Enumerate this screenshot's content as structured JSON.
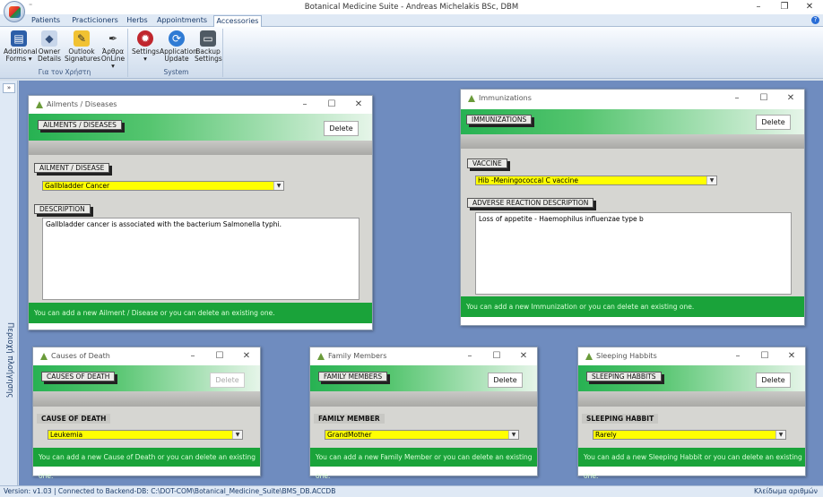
{
  "app": {
    "title": "Botanical Medicine Suite - Andreas Michelakis BSc, DBM",
    "qat_glyph": "⁼",
    "controls": {
      "minimize": "–",
      "restore": "❐",
      "close": "✕"
    }
  },
  "tabs": [
    "Patients",
    "Practicioners",
    "Herbs",
    "Appointments",
    "Accessories"
  ],
  "active_tab": "Accessories",
  "ribbon": {
    "groups": [
      {
        "label": "Για τον Χρήστη",
        "buttons": [
          {
            "line1": "Additional",
            "line2": "Forms ▾",
            "icon": "forms-icon"
          },
          {
            "line1": "Owner",
            "line2": "Details",
            "icon": "owner-icon"
          },
          {
            "line1": "Outlook",
            "line2": "Signatures",
            "icon": "outlook-icon"
          },
          {
            "line1": "Άρθρα",
            "line2": "OnLine ▾",
            "icon": "articles-icon"
          }
        ]
      },
      {
        "label": "System",
        "buttons": [
          {
            "line1": "Settings",
            "line2": "▾",
            "icon": "settings-icon"
          },
          {
            "line1": "Application",
            "line2": "Update",
            "icon": "update-icon"
          },
          {
            "line1": "Backup",
            "line2": "Settings",
            "icon": "backup-icon"
          }
        ]
      }
    ]
  },
  "sidebar": {
    "chevron": "»",
    "label": "Περιοχή πλοήγησης"
  },
  "windows": {
    "ailments": {
      "title": "Ailments / Diseases",
      "header_label": "AILMENTS / DISEASES",
      "delete_label": "Delete",
      "field_label": "AILMENT / DISEASE",
      "field_value": "Gallbladder Cancer",
      "desc_label": "DESCRIPTION",
      "desc_value": "Gallbladder cancer is associated with the bacterium Salmonella typhi.",
      "footer": "You can add a new Ailment / Disease or you can delete an existing one."
    },
    "immunizations": {
      "title": "Immunizations",
      "header_label": "IMMUNIZATIONS",
      "delete_label": "Delete",
      "field_label": "VACCINE",
      "field_value": "Hib -Meningococcal C vaccine",
      "desc_label": "ADVERSE REACTION DESCRIPTION",
      "desc_value": "Loss of appetite - Haemophilus influenzae type b",
      "footer": "You can add a new Immunization or you can delete an existing one."
    },
    "death": {
      "title": "Causes of Death",
      "header_label": "CAUSES OF DEATH",
      "delete_label": "Delete",
      "field_label": "CAUSE OF DEATH",
      "field_value": "Leukemia",
      "footer": "You can add a new Cause of Death or you can delete an existing one."
    },
    "family": {
      "title": "Family Members",
      "header_label": "FAMILY MEMBERS",
      "delete_label": "Delete",
      "field_label": "FAMILY MEMBER",
      "field_value": "GrandMother",
      "footer": "You can add a new Family Member or you can delete an existing one."
    },
    "sleeping": {
      "title": "Sleeping Habbits",
      "header_label": "SLEEPING HABBITS",
      "delete_label": "Delete",
      "field_label": "SLEEPING HABBIT",
      "field_value": "Rarely",
      "footer": "You can add a new Sleeping Habbit or you can delete an existing one."
    }
  },
  "status": {
    "left": "Version: v1.03  |  Connected to Backend-DB: C:\\DOT-COM\\Botanical_Medicine_Suite\\BMS_DB.ACCDB",
    "right": "Κλείδωμα αριθμών"
  },
  "colors": {
    "green": "#1aa33a",
    "yellow": "#ffff00",
    "mdi": "#6f8cbf"
  }
}
